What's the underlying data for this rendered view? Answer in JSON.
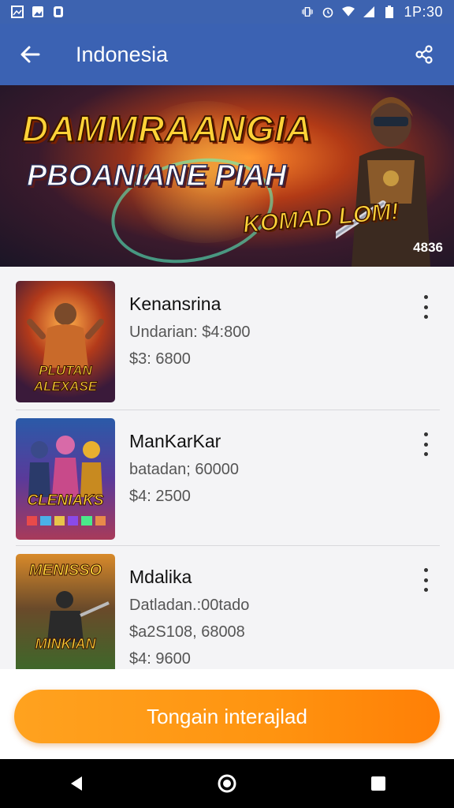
{
  "status_bar": {
    "time": "1P:30",
    "left_icons": [
      "gallery-icon",
      "photo-icon",
      "notification-icon"
    ],
    "right_icons": [
      "vibrate-icon",
      "alarm-icon",
      "wifi-icon",
      "signal-icon",
      "battery-icon"
    ]
  },
  "app_bar": {
    "title": "Indonesia",
    "back_icon": "arrow-left-icon",
    "share_icon": "share-icon",
    "color": "#3b62b3"
  },
  "banner": {
    "line1": "DAMMRAANGIA",
    "line2": "PBOANIANE PIAH",
    "line3": "KOMAD LOM!",
    "code": "4836"
  },
  "items": [
    {
      "name": "Kenansrina",
      "line1": "Undarian: $4:800",
      "line2": "$3: 6800",
      "line3": "",
      "thumb_title": "PLUTAN ALEXASE"
    },
    {
      "name": "ManKarKar",
      "line1": "batadan; 60000",
      "line2": "$4: 2500",
      "line3": "",
      "thumb_title": "CLENIAKS"
    },
    {
      "name": "Mdalika",
      "line1": "Datladan.:00tado",
      "line2": "$a2S108, 68008",
      "line3": "$4: 9600",
      "thumb_title_top": "MENISSO",
      "thumb_title": "MINKIAN"
    }
  ],
  "cta": {
    "label": "Tongain interajlad",
    "color": "#ff9410"
  },
  "nav_bar": {
    "icons": [
      "back-triangle-icon",
      "home-circle-icon",
      "recents-square-icon"
    ]
  }
}
